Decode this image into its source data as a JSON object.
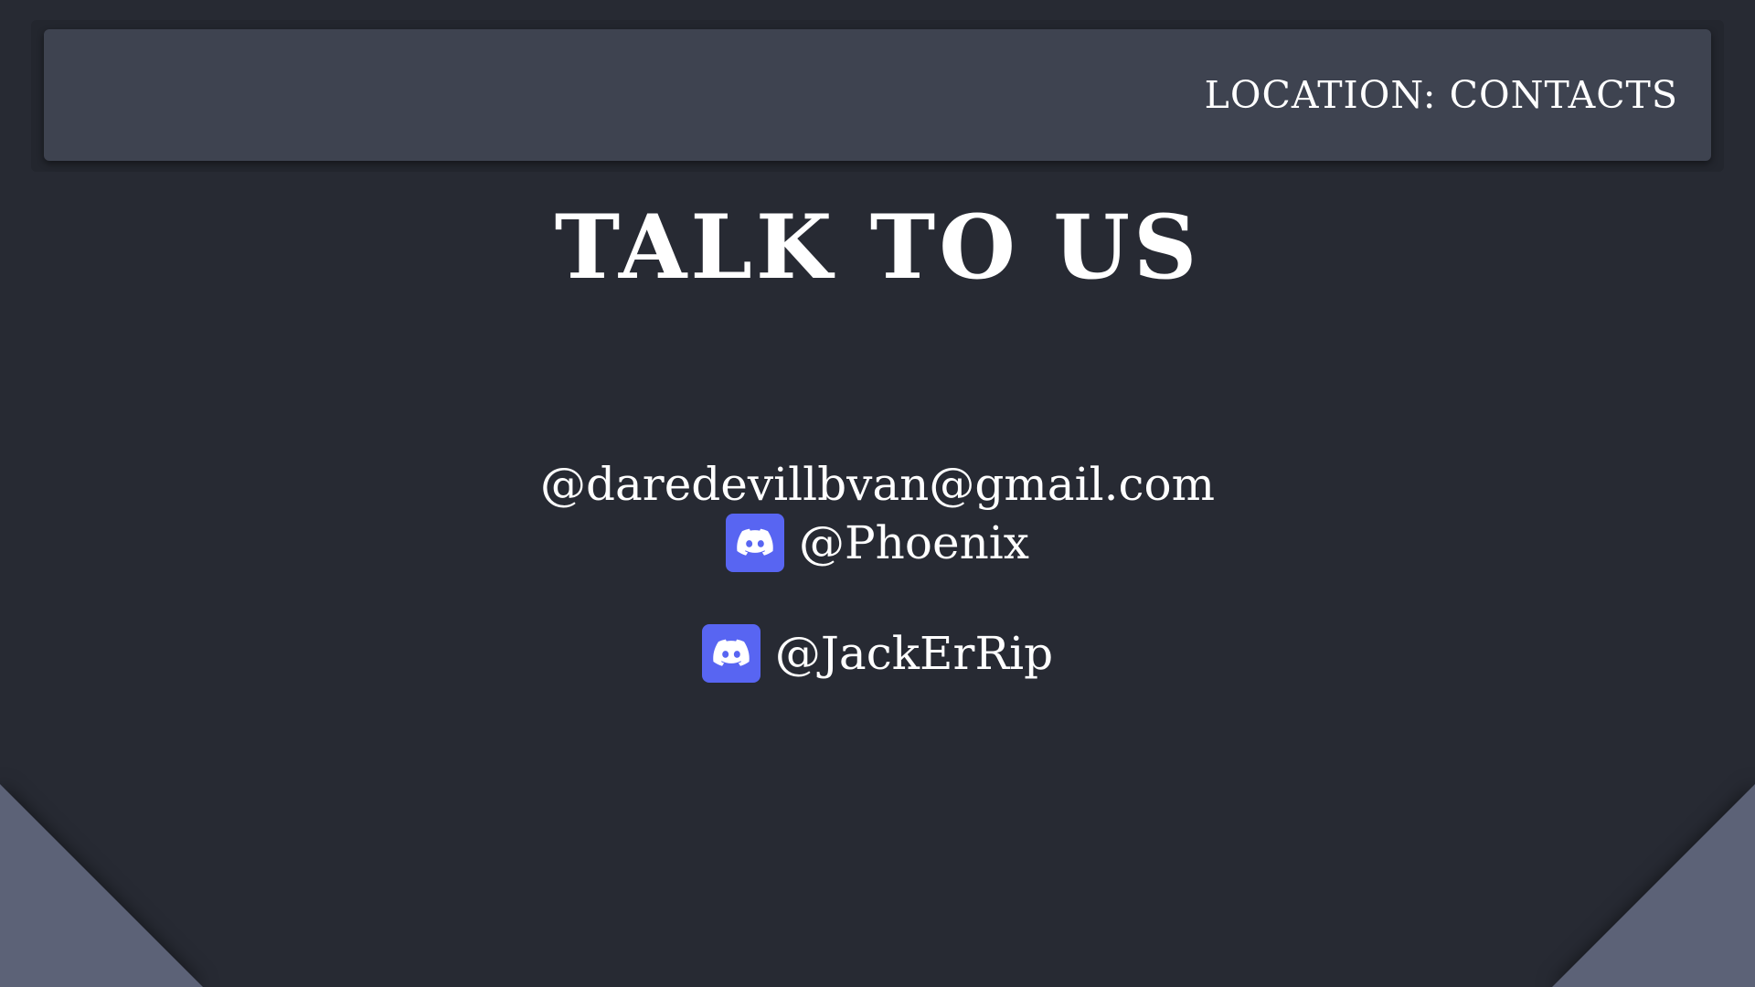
{
  "header": {
    "location_text": "LOCATION: CONTACTS"
  },
  "main": {
    "title": "TALK TO US",
    "email": "@daredevillbvan@gmail.com",
    "contacts": [
      {
        "icon": "discord-icon",
        "handle": "@Phoenix"
      },
      {
        "icon": "discord-icon",
        "handle": "@JackErRip"
      }
    ]
  },
  "colors": {
    "background": "#272a33",
    "header": "#3e4350",
    "corner_accent": "#5c6277",
    "discord_brand": "#5865f2",
    "text": "#ffffff"
  }
}
